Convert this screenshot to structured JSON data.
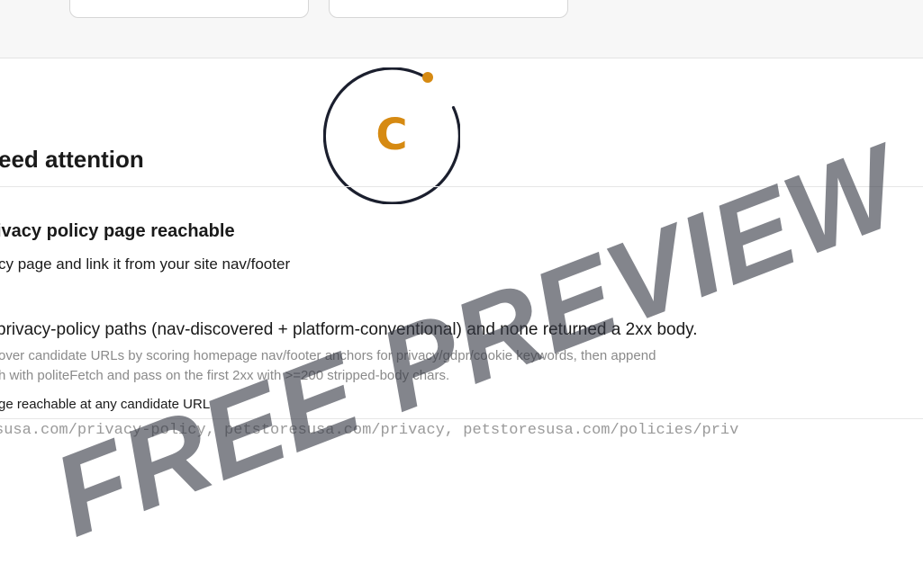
{
  "logo": {
    "letter": "C",
    "ring_color": "#1b1f2e",
    "accent_color": "#d68a12"
  },
  "section": {
    "title": "eed attention"
  },
  "issue": {
    "title": "ivacy policy page reachable",
    "action": "cy page and link it from your site nav/footer",
    "detail": "privacy-policy paths (nav-discovered + platform-conventional) and none returned a 2xx body.",
    "method_line_1": "over candidate URLs by scoring homepage nav/footer anchors for privacy/gdpr/cookie keywords, then append",
    "method_line_2": "h with politeFetch and pass on the first 2xx with >=200 stripped-body chars.",
    "status": "ge reachable at any candidate URL",
    "urls": "susa.com/privacy-policy, petstoresusa.com/privacy, petstoresusa.com/policies/priv"
  },
  "watermark": {
    "text": "FREE PREVIEW"
  }
}
